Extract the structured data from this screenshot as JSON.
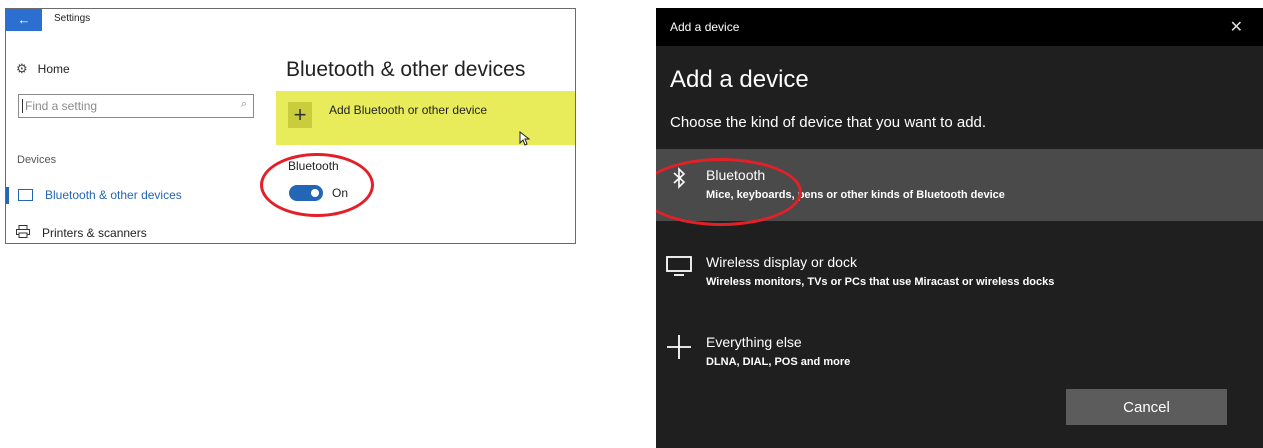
{
  "settings": {
    "title": "Settings",
    "back_icon": "back-arrow-icon",
    "home_label": "Home",
    "search_placeholder": "Find a setting",
    "section_label": "Devices",
    "nav_items": [
      {
        "label": "Bluetooth & other devices",
        "icon": "bluetooth-devices-icon",
        "selected": true
      },
      {
        "label": "Printers & scanners",
        "icon": "printer-icon",
        "selected": false
      }
    ],
    "heading": "Bluetooth & other devices",
    "add_device_label": "Add Bluetooth or other device",
    "bluetooth_label": "Bluetooth",
    "toggle_state_label": "On",
    "highlight_color": "#e8ec5a",
    "accent_color": "#2466b6"
  },
  "dialog": {
    "title": "Add a device",
    "heading": "Add a device",
    "subtitle": "Choose the kind of device that you want to add.",
    "options": [
      {
        "title": "Bluetooth",
        "description": "Mice, keyboards, pens or other kinds of Bluetooth device",
        "icon": "bluetooth-icon",
        "selected": true
      },
      {
        "title": "Wireless display or dock",
        "description": "Wireless monitors, TVs or PCs that use Miracast or wireless docks",
        "icon": "monitor-icon",
        "selected": false
      },
      {
        "title": "Everything else",
        "description": "DLNA, DIAL, POS and more",
        "icon": "plus-icon",
        "selected": false
      }
    ],
    "cancel_label": "Cancel"
  },
  "annotation_color": "#e32028"
}
